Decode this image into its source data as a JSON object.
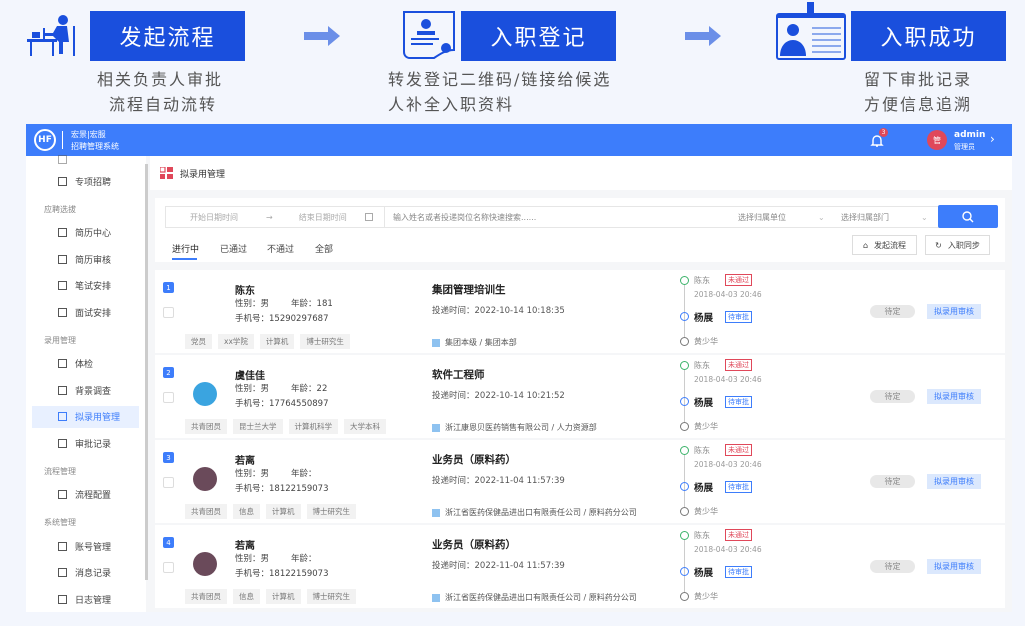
{
  "banner": {
    "steps": [
      {
        "title": "发起流程",
        "lines": [
          "相关负责人审批",
          "流程自动流转"
        ]
      },
      {
        "title": "入职登记",
        "lines": [
          "转发登记二维码/链接给候选",
          "人补全入职资料"
        ]
      },
      {
        "title": "入职成功",
        "lines": [
          "留下审批记录",
          "方便信息追溯"
        ]
      }
    ]
  },
  "header": {
    "logo": "HF",
    "brand1": "宏景|宏服",
    "brand2": "招聘管理系统",
    "notif_count": "3",
    "avatar_char": "管",
    "user": "admin",
    "role": "管理员"
  },
  "sidebar": {
    "items": [
      {
        "type": "item",
        "label": "专项招聘"
      },
      {
        "type": "group",
        "label": "应聘选拔"
      },
      {
        "type": "item",
        "label": "简历中心"
      },
      {
        "type": "item",
        "label": "简历审核"
      },
      {
        "type": "item",
        "label": "笔试安排"
      },
      {
        "type": "item",
        "label": "面试安排"
      },
      {
        "type": "group",
        "label": "录用管理"
      },
      {
        "type": "item",
        "label": "体检"
      },
      {
        "type": "item",
        "label": "背景调查"
      },
      {
        "type": "item",
        "label": "拟录用管理",
        "active": true
      },
      {
        "type": "item",
        "label": "审批记录"
      },
      {
        "type": "group",
        "label": "流程管理"
      },
      {
        "type": "item",
        "label": "流程配置"
      },
      {
        "type": "group",
        "label": "系统管理"
      },
      {
        "type": "item",
        "label": "账号管理"
      },
      {
        "type": "item",
        "label": "消息记录"
      },
      {
        "type": "item",
        "label": "日志管理"
      }
    ]
  },
  "page_title": "拟录用管理",
  "filter": {
    "start_placeholder": "开始日期时间",
    "arrow": "→",
    "end_placeholder": "结束日期时间",
    "search_placeholder": "输入姓名或者投递岗位名称快速搜索......",
    "unit_placeholder": "选择归属单位",
    "dept_placeholder": "选择归属部门",
    "tabs": [
      "进行中",
      "已通过",
      "不通过",
      "全部"
    ],
    "start_flow": "发起流程",
    "sync": "入职同步"
  },
  "labels": {
    "gender": "性别：",
    "age": "年龄：",
    "phone": "手机号：",
    "submit_time": "投递时间：",
    "pending": "待定",
    "review": "拟录用审核"
  },
  "rows": [
    {
      "idx": "1",
      "name": "陈东",
      "gender": "男",
      "age": "181",
      "phone": "15290297687",
      "tags": [
        "党员",
        "xx学院",
        "计算机",
        "博士研究生"
      ],
      "job": "集团管理培训生",
      "time": "2022-10-14 10:18:35",
      "org": "集团本级 / 集团本部",
      "avatar": "#ffffff"
    },
    {
      "idx": "2",
      "name": "虞佳佳",
      "gender": "男",
      "age": "22",
      "phone": "17764550897",
      "tags": [
        "共青团员",
        "昆士兰大学",
        "计算机科学",
        "大学本科"
      ],
      "job": "软件工程师",
      "time": "2022-10-14 10:21:52",
      "org": "浙江康恩贝医药销售有限公司 / 人力资源部",
      "avatar": "#3aa4e0"
    },
    {
      "idx": "3",
      "name": "若离",
      "gender": "男",
      "age": "",
      "phone": "18122159073",
      "tags": [
        "共青团员",
        "信息",
        "计算机",
        "博士研究生"
      ],
      "job": "业务员（原料药）",
      "time": "2022-11-04 11:57:39",
      "org": "浙江省医药保健品进出口有限责任公司 / 原料药分公司",
      "avatar": "#6a4a5a"
    },
    {
      "idx": "4",
      "name": "若离",
      "gender": "男",
      "age": "",
      "phone": "18122159073",
      "tags": [
        "共青团员",
        "信息",
        "计算机",
        "博士研究生"
      ],
      "job": "业务员（原料药）",
      "time": "2022-11-04 11:57:39",
      "org": "浙江省医药保健品进出口有限责任公司 / 原料药分公司",
      "avatar": "#6a4a5a"
    }
  ],
  "timeline": {
    "first": "陈东",
    "first_status": "未通过",
    "first_time": "2018-04-03 20:46",
    "second": "杨展",
    "second_status": "待审批",
    "third": "黄少华"
  },
  "colors": {
    "primary": "#3d7dfb",
    "banner": "#1a4fdd",
    "danger": "#e0485a",
    "success": "#3bb36a"
  }
}
